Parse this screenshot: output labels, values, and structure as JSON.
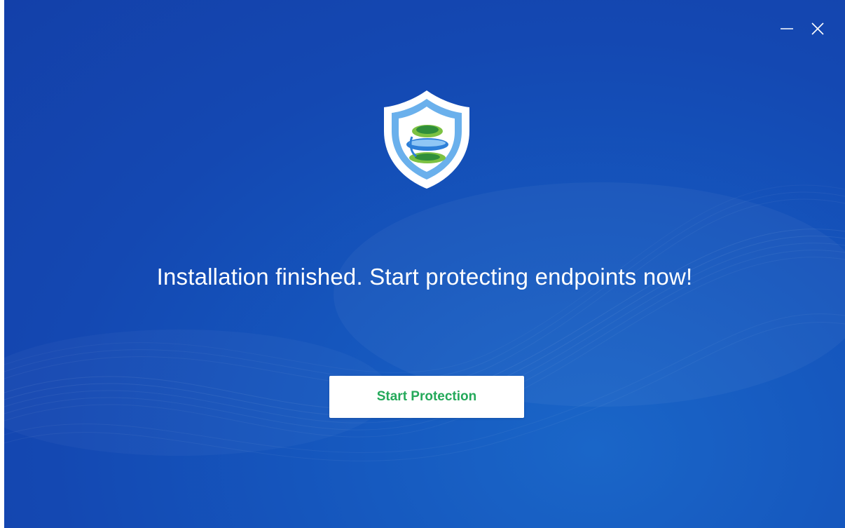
{
  "window": {
    "controls": [
      {
        "name": "minimize-icon"
      },
      {
        "name": "close-icon"
      }
    ]
  },
  "logo": {
    "icon": "shield-globe-icon"
  },
  "main": {
    "headline": "Installation finished. Start protecting endpoints now!",
    "start_button_label": "Start Protection"
  },
  "colors": {
    "background": "#1448b2",
    "button_text": "#24a95a",
    "text": "#ffffff"
  }
}
